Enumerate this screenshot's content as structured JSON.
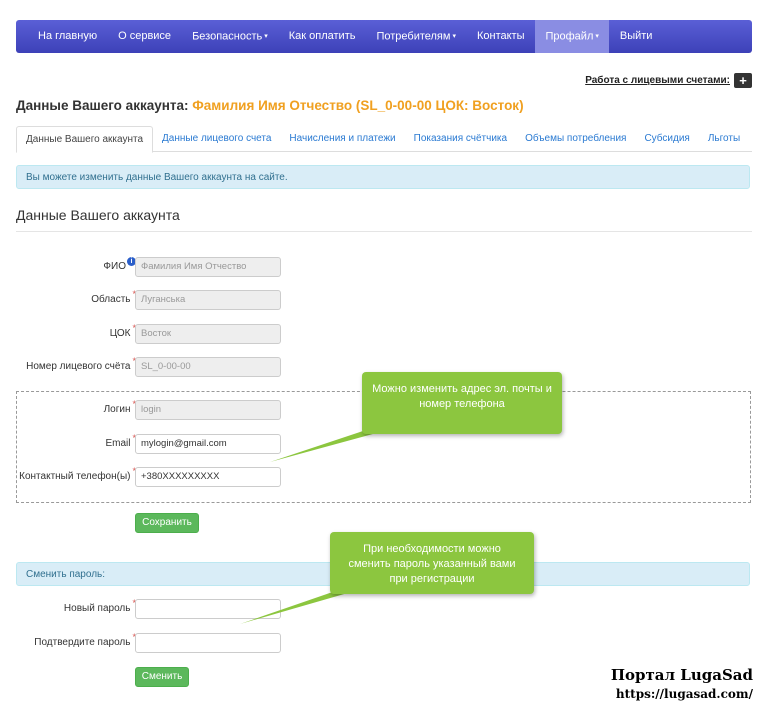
{
  "nav": {
    "items": [
      {
        "label": "На главную"
      },
      {
        "label": "О сервисе"
      },
      {
        "label": "Безопасность",
        "caret": "▾"
      },
      {
        "label": "Как оплатить"
      },
      {
        "label": "Потребителям",
        "caret": "▾"
      },
      {
        "label": "Контакты"
      },
      {
        "label": "Профайл",
        "caret": "▾",
        "active": true
      },
      {
        "label": "Выйти"
      }
    ]
  },
  "accounts_link": {
    "label": "Работа с лицевыми счетами:",
    "icon": "plus-icon",
    "icon_glyph": "+"
  },
  "page_heading": {
    "prefix": "Данные Вашего аккаунта:",
    "name": "Фамилия Имя Отчество (SL_0-00-00 ЦОК: Восток)"
  },
  "tabs": [
    {
      "label": "Данные Вашего аккаунта",
      "active": true
    },
    {
      "label": "Данные лицевого счета"
    },
    {
      "label": "Начисления и платежи"
    },
    {
      "label": "Показания счётчика"
    },
    {
      "label": "Объемы потребления"
    },
    {
      "label": "Субсидия"
    },
    {
      "label": "Льготы"
    }
  ],
  "info_message": "Вы можете изменить данные Вашего аккаунта на сайте.",
  "section_title": "Данные Вашего аккаунта",
  "form": {
    "fio": {
      "label": "ФИО",
      "value": "Фамилия Имя Отчество",
      "info_icon": "i"
    },
    "region": {
      "label": "Область",
      "value": "Луганська",
      "required": "*"
    },
    "cok": {
      "label": "ЦОК",
      "value": "Восток",
      "required": "*"
    },
    "account_number": {
      "label": "Номер лицевого счёта",
      "value": "SL_0-00-00",
      "required": "*"
    },
    "login": {
      "label": "Логин",
      "value": "login",
      "required": "*"
    },
    "email": {
      "label": "Email",
      "value": "mylogin@gmail.com",
      "required": "*"
    },
    "phone": {
      "label": "Контактный телефон(ы)",
      "value": "+380XXXXXXXXX",
      "required": "*"
    },
    "save_label": "Сохранить"
  },
  "password_section": {
    "title": "Сменить пароль:",
    "new_password": {
      "label": "Новый пароль",
      "value": "",
      "required": "*"
    },
    "confirm_password": {
      "label": "Подтвердите пароль",
      "value": "",
      "required": "*"
    },
    "change_label": "Сменить"
  },
  "callouts": {
    "contact": "Можно изменить адрес эл. почты и номер телефона",
    "password": "При необходимости можно сменить пароль указанный вами при регистрации"
  },
  "brand": {
    "title": "Портал LugaSad",
    "url": "https://lugasad.com/"
  },
  "colors": {
    "navbar": "#4a4ec8",
    "active_nav": "#8a8de3",
    "accent_orange": "#f0a020",
    "link_blue": "#2a7ad2",
    "button_green": "#5cb85c",
    "callout_green": "#8cc63f",
    "info_bg": "#d9edf7"
  }
}
